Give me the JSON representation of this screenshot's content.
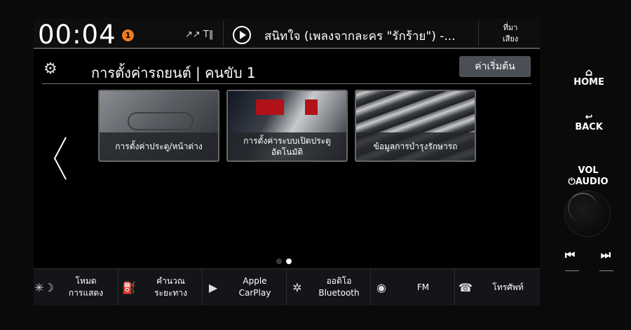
{
  "status": {
    "time": "00:04",
    "notification_count": "1",
    "signal": "↗↗ T‖",
    "track": "สนิทใจ (เพลงจากละคร \"รักร้าย\") -...",
    "source_line1": "ที่มา",
    "source_line2": "เสียง"
  },
  "header": {
    "title": "การตั้งค่ารถยนต์ | คนขับ 1",
    "reset_label": "ค่าเริ่มต้น"
  },
  "tiles": [
    {
      "label": "การตั้งค่าประตู/หน้าต่าง"
    },
    {
      "label": "การตั้งค่าระบบเปิดประตู อัตโนมัติ"
    },
    {
      "label": "ข้อมูลการบำรุงรักษารถ"
    }
  ],
  "pager": {
    "current": 2,
    "total": 2
  },
  "nav": [
    {
      "icon": "display-mode-icon",
      "glyph": "✳☽",
      "line1": "โหมด",
      "line2": "การแสดง"
    },
    {
      "icon": "fuel-calc-icon",
      "glyph": "⛽",
      "line1": "คำนวณ",
      "line2": "ระยะทาง"
    },
    {
      "icon": "carplay-icon",
      "glyph": "▶",
      "line1": "Apple",
      "line2": "CarPlay"
    },
    {
      "icon": "bluetooth-icon",
      "glyph": "✲",
      "line1": "ออดิโอ",
      "line2": "Bluetooth"
    },
    {
      "icon": "fm-radio-icon",
      "glyph": "◉",
      "line1": "FM",
      "line2": ""
    },
    {
      "icon": "phone-icon",
      "glyph": "☎",
      "line1": "โทรศัพท์",
      "line2": ""
    }
  ],
  "hardware": {
    "home": "HOME",
    "back": "BACK",
    "vol": "VOL",
    "audio": "⏻AUDIO",
    "prev": "⏮",
    "next": "⏭"
  },
  "colors": {
    "notification": "#f07a1e",
    "reset_button": "#4a4f55"
  }
}
